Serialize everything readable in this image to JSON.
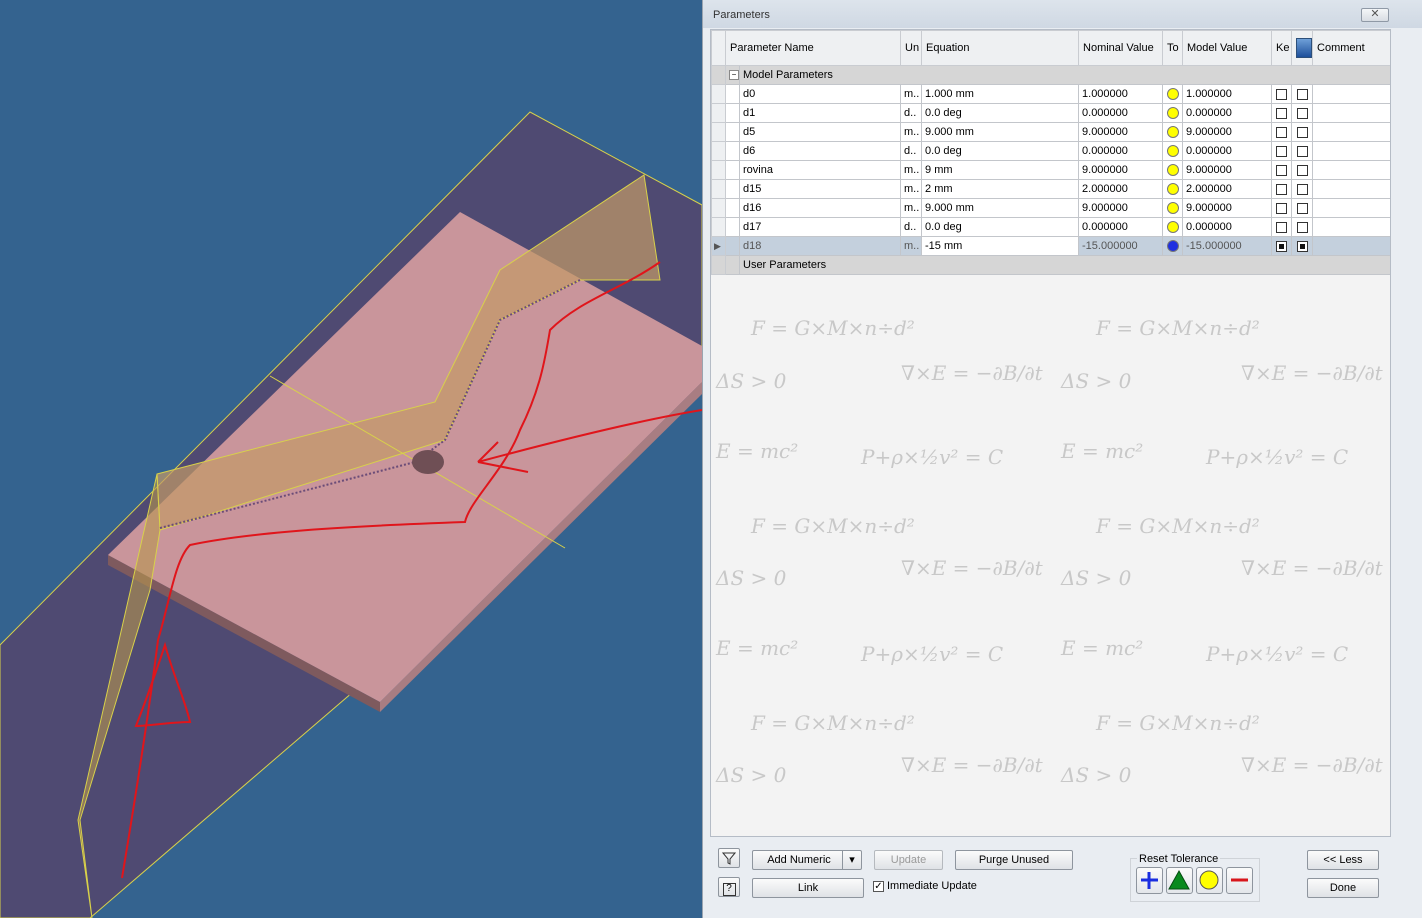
{
  "window": {
    "title": "Parameters",
    "close_icon": "✕"
  },
  "table": {
    "headers": [
      "Parameter Name",
      "Un",
      "Equation",
      "Nominal Value",
      "To",
      "Model Value",
      "Ke",
      "",
      "Comment"
    ],
    "groups": {
      "model": "Model Parameters",
      "user": "User Parameters"
    },
    "rows": [
      {
        "name": "d0",
        "unit": "m..",
        "equation": "1.000 mm",
        "nominal": "1.000000",
        "tol_color": "#ffff00",
        "model": "1.000000",
        "key": false,
        "export": false,
        "comment": ""
      },
      {
        "name": "d1",
        "unit": "d..",
        "equation": "0.0 deg",
        "nominal": "0.000000",
        "tol_color": "#ffff00",
        "model": "0.000000",
        "key": false,
        "export": false,
        "comment": ""
      },
      {
        "name": "d5",
        "unit": "m..",
        "equation": "9.000 mm",
        "nominal": "9.000000",
        "tol_color": "#ffff00",
        "model": "9.000000",
        "key": false,
        "export": false,
        "comment": ""
      },
      {
        "name": "d6",
        "unit": "d..",
        "equation": "0.0 deg",
        "nominal": "0.000000",
        "tol_color": "#ffff00",
        "model": "0.000000",
        "key": false,
        "export": false,
        "comment": ""
      },
      {
        "name": "rovina",
        "unit": "m..",
        "equation": "9 mm",
        "nominal": "9.000000",
        "tol_color": "#ffff00",
        "model": "9.000000",
        "key": false,
        "export": false,
        "comment": ""
      },
      {
        "name": "d15",
        "unit": "m..",
        "equation": "2 mm",
        "nominal": "2.000000",
        "tol_color": "#ffff00",
        "model": "2.000000",
        "key": false,
        "export": false,
        "comment": ""
      },
      {
        "name": "d16",
        "unit": "m..",
        "equation": "9.000 mm",
        "nominal": "9.000000",
        "tol_color": "#ffff00",
        "model": "9.000000",
        "key": false,
        "export": false,
        "comment": ""
      },
      {
        "name": "d17",
        "unit": "d..",
        "equation": "0.0 deg",
        "nominal": "0.000000",
        "tol_color": "#ffff00",
        "model": "0.000000",
        "key": false,
        "export": false,
        "comment": ""
      },
      {
        "name": "d18",
        "unit": "m..",
        "equation": "-15 mm",
        "nominal": "-15.000000",
        "tol_color": "#1f2fe0",
        "model": "-15.000000",
        "key": true,
        "export": true,
        "comment": "",
        "selected": true
      }
    ]
  },
  "buttons": {
    "filter_icon": "filter-icon",
    "help_icon": "?",
    "add_numeric": "Add Numeric",
    "add_numeric_dropdown": "▾",
    "update": "Update",
    "purge_unused": "Purge Unused",
    "link": "Link",
    "immediate_update": "Immediate Update",
    "immediate_update_checked": true,
    "reset_tolerance": "Reset Tolerance",
    "less": "<< Less",
    "done": "Done"
  },
  "colors": {
    "viewport_bg": "#34638f",
    "plate": "#c9959b",
    "annotation": "#e0151b",
    "tol_upper": "#1a2ee0",
    "tol_lower": "#d8161b"
  }
}
